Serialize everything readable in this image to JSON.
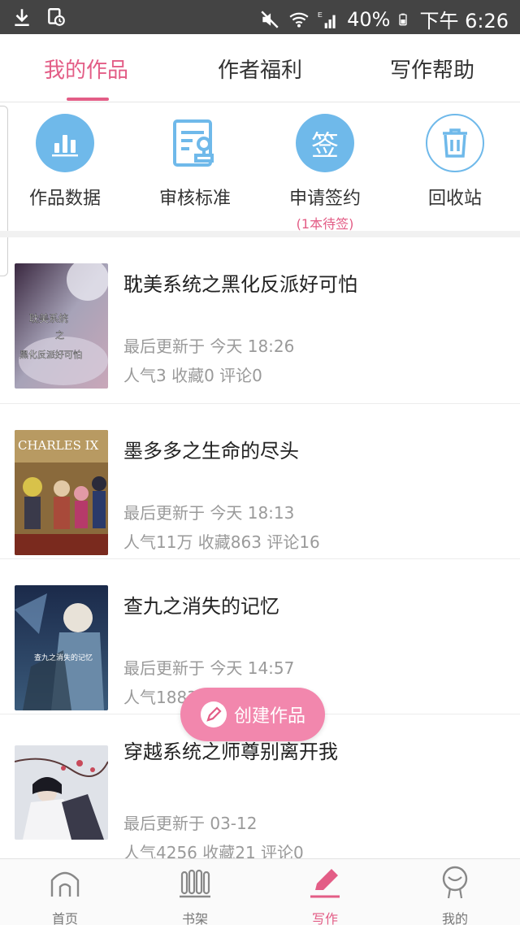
{
  "status_bar": {
    "battery": "40%",
    "time": "下午 6:26",
    "network_label": "E"
  },
  "tabs": [
    {
      "label": "我的作品",
      "active": true
    },
    {
      "label": "作者福利",
      "active": false
    },
    {
      "label": "写作帮助",
      "active": false
    }
  ],
  "actions": [
    {
      "label": "作品数据",
      "icon": "bar-chart-icon"
    },
    {
      "label": "审核标准",
      "icon": "document-stamp-icon"
    },
    {
      "label": "申请签约",
      "icon": "sign-icon",
      "icon_text": "签",
      "sublabel": "(1本待签)"
    },
    {
      "label": "回收站",
      "icon": "trash-icon"
    }
  ],
  "works": [
    {
      "title": "耽美系统之黑化反派好可怕",
      "updated": "最后更新于 今天 18:26",
      "stats": "人气3  收藏0  评论0",
      "cover_text": [
        "耽美系统",
        "之",
        "黑化反派好可怕"
      ]
    },
    {
      "title": "墨多多之生命的尽头",
      "updated": "最后更新于 今天 18:13",
      "stats": "人气11万  收藏863  评论16",
      "cover_text": [
        "CHARLES IX"
      ]
    },
    {
      "title": "查九之消失的记忆",
      "updated": "最后更新于 今天 14:57",
      "stats": "人气1883  收藏16  评论2",
      "cover_text": [
        "查九之消失的记忆"
      ]
    },
    {
      "title": "穿越系统之师尊别离开我",
      "updated": "最后更新于 03-12",
      "stats": "人气4256  收藏21  评论0",
      "cover_text": []
    }
  ],
  "fab": {
    "label": "创建作品",
    "icon": "pencil-icon"
  },
  "bottom_nav": [
    {
      "label": "首页",
      "icon": "home-icon",
      "active": false
    },
    {
      "label": "书架",
      "icon": "bookshelf-icon",
      "active": false
    },
    {
      "label": "写作",
      "icon": "pen-icon",
      "active": true
    },
    {
      "label": "我的",
      "icon": "profile-icon",
      "active": false
    }
  ],
  "colors": {
    "accent": "#e35d86",
    "fab": "#f287ad",
    "action_blue": "#6fb9ea",
    "status_bar": "#444444"
  }
}
